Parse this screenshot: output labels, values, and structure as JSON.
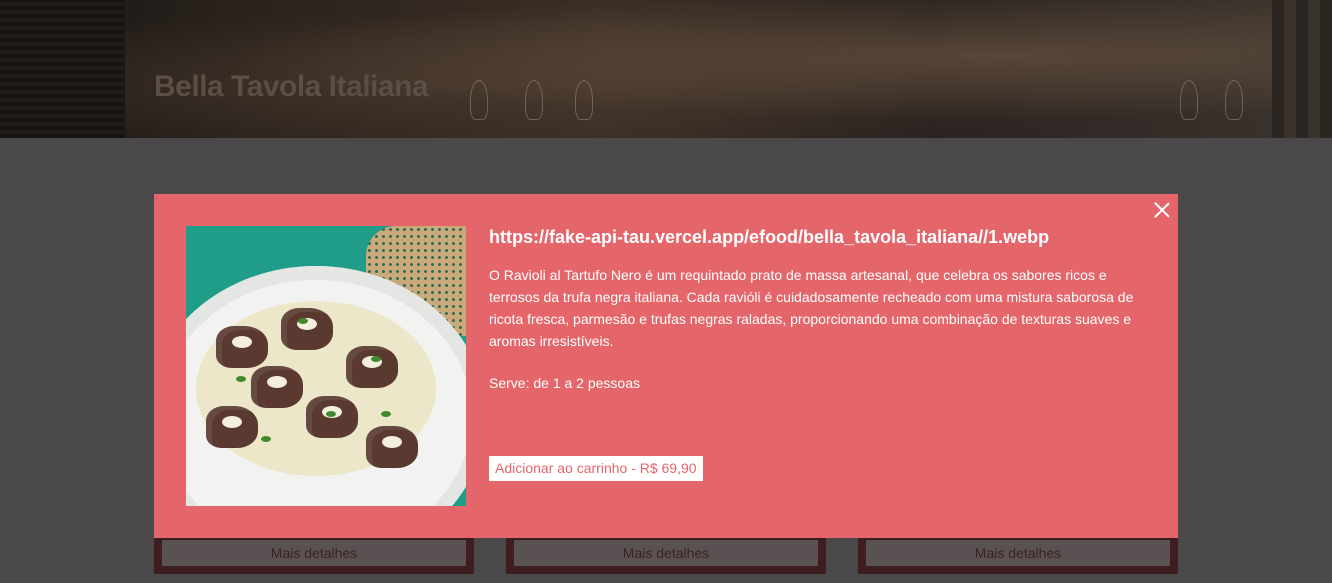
{
  "hero": {
    "title": "Bella Tavola Italiana"
  },
  "cards": [
    {
      "more_label": "Mais detalhes"
    },
    {
      "more_label": "Mais detalhes"
    },
    {
      "more_label": "Mais detalhes"
    }
  ],
  "modal": {
    "title": "https://fake-api-tau.vercel.app/efood/bella_tavola_italiana//1.webp",
    "description": "O Ravioli al Tartufo Nero é um requintado prato de massa artesanal, que celebra os sabores ricos e terrosos da trufa negra italiana. Cada ravióli é cuidadosamente recheado com uma mistura saborosa de ricota fresca, parmesão e trufas negras raladas, proporcionando uma combinação de texturas suaves e aromas irresistíveis.",
    "serves": "Serve: de 1 a 2 pessoas",
    "add_button": "Adicionar ao carrinho - R$ 69,90",
    "close_icon": "close-icon"
  },
  "colors": {
    "overlay_bg": "#4a4848",
    "modal_bg": "#e5666a",
    "button_bg": "#ffffff",
    "button_text": "#e5666a"
  }
}
